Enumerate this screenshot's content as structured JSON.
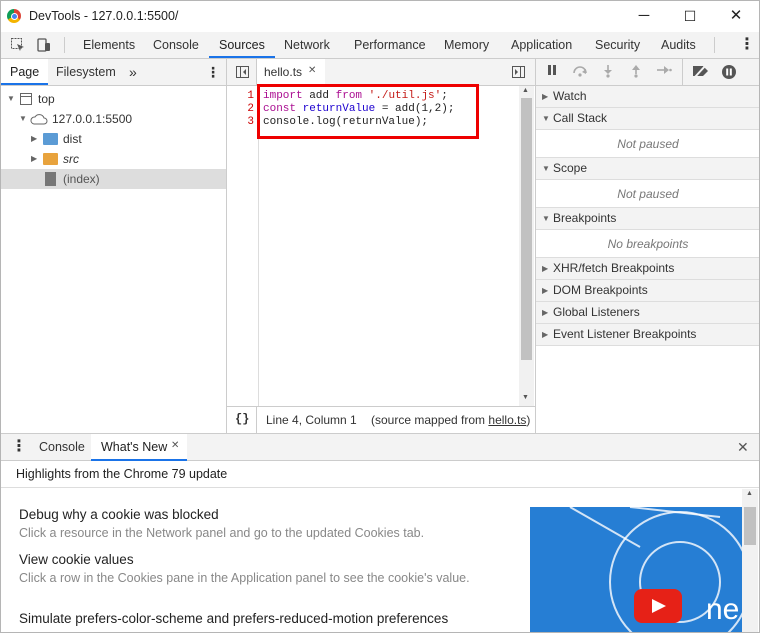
{
  "window": {
    "title": "DevTools - 127.0.0.1:5500/",
    "minimize": "─",
    "maximize": "☐",
    "close": "✕"
  },
  "toolbar": {
    "tabs": [
      "Elements",
      "Console",
      "Sources",
      "Network",
      "Performance",
      "Memory",
      "Application",
      "Security",
      "Audits"
    ],
    "active_tab": "Sources",
    "more": "⋮"
  },
  "navigator": {
    "tabs": [
      "Page",
      "Filesystem"
    ],
    "more_tabs": "»",
    "menu": "⋮",
    "tree": [
      {
        "label": "top",
        "icon": "frame-icon",
        "expanded": true
      },
      {
        "label": "127.0.0.1:5500",
        "icon": "cloud-icon",
        "expanded": true
      },
      {
        "label": "dist",
        "icon": "folder-icon",
        "color": "#5b9bd5"
      },
      {
        "label": "src",
        "icon": "folder-icon",
        "color": "#e8a33d"
      },
      {
        "label": "(index)",
        "icon": "file-icon",
        "selected": true
      }
    ]
  },
  "editor": {
    "file_tab": "hello.ts",
    "file_tab_close": "✕",
    "lines": [
      {
        "num": "1",
        "parts": [
          [
            "kw",
            "import"
          ],
          [
            "t",
            " add "
          ],
          [
            "kw",
            "from"
          ],
          [
            "t",
            " "
          ],
          [
            "str",
            "'./util.js'"
          ],
          [
            "t",
            ";"
          ]
        ]
      },
      {
        "num": "2",
        "parts": [
          [
            "kw",
            "const"
          ],
          [
            "t",
            " "
          ],
          [
            "var",
            "returnValue"
          ],
          [
            "t",
            " = add(1,2);"
          ]
        ]
      },
      {
        "num": "3",
        "parts": [
          [
            "t",
            "console.log(returnValue);"
          ]
        ]
      }
    ],
    "status": {
      "braces": "{}",
      "position": "Line 4, Column 1",
      "source_prefix": "(source mapped from ",
      "source_link": "hello.ts",
      "source_suffix": ")"
    }
  },
  "debugger": {
    "sections": [
      {
        "title": "Watch",
        "body": null
      },
      {
        "title": "Call Stack",
        "body": "Not paused"
      },
      {
        "title": "Scope",
        "body": "Not paused"
      },
      {
        "title": "Breakpoints",
        "body": "No breakpoints"
      },
      {
        "title": "XHR/fetch Breakpoints",
        "body": null
      },
      {
        "title": "DOM Breakpoints",
        "body": null
      },
      {
        "title": "Global Listeners",
        "body": null
      },
      {
        "title": "Event Listener Breakpoints",
        "body": null
      }
    ]
  },
  "drawer": {
    "tabs": [
      "Console",
      "What's New"
    ],
    "active_tab": "What's New",
    "menu": "⋮",
    "close": "✕",
    "header": "Highlights from the Chrome 79 update",
    "items": [
      {
        "title": "Debug why a cookie was blocked",
        "desc": "Click a resource in the Network panel and go to the updated Cookies tab."
      },
      {
        "title": "View cookie values",
        "desc": "Click a row in the Cookies pane in the Application panel to see the cookie's value."
      },
      {
        "title": "Simulate prefers-color-scheme and prefers-reduced-motion preferences",
        "desc": ""
      }
    ],
    "promo_text": "ne"
  },
  "colors": {
    "accent": "#1a73e8",
    "highlight_box": "#e00000",
    "promo_bg": "#1976d2",
    "youtube_red": "#e62117"
  }
}
